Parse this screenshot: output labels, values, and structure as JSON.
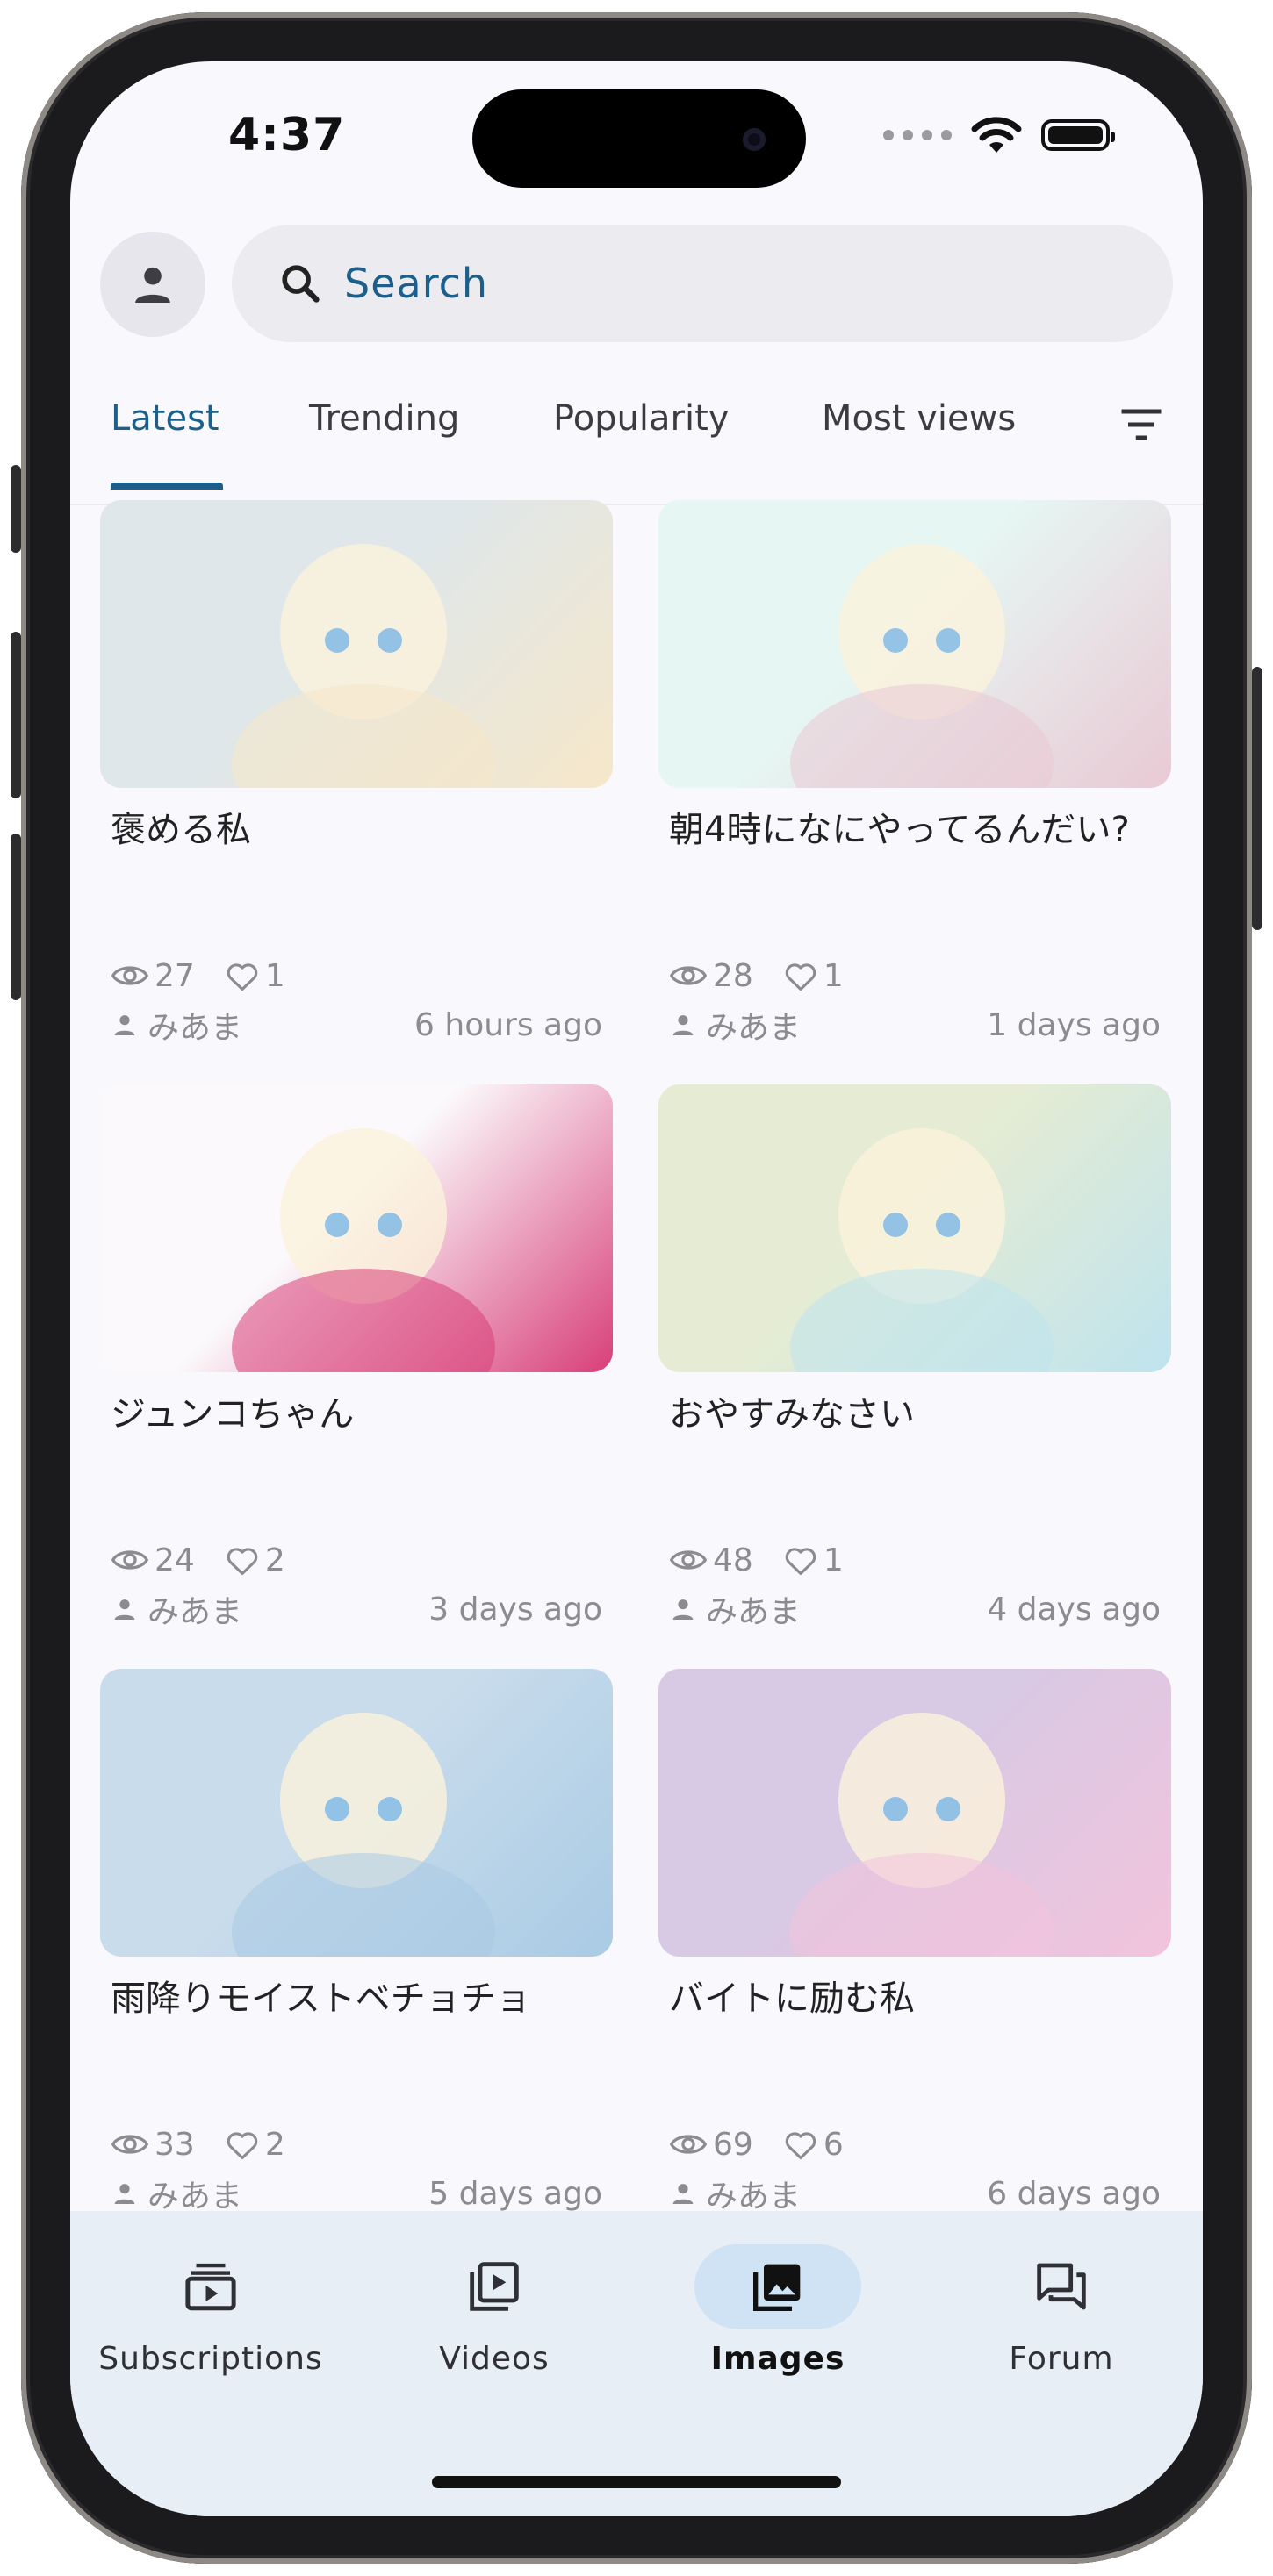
{
  "status_bar": {
    "time": "4:37"
  },
  "search": {
    "placeholder": "Search"
  },
  "tabs": [
    {
      "label": "Latest",
      "active": true
    },
    {
      "label": "Trending",
      "active": false
    },
    {
      "label": "Popularity",
      "active": false
    },
    {
      "label": "Most views",
      "active": false
    }
  ],
  "cards": [
    {
      "title": "褒める私",
      "views": "27",
      "likes": "1",
      "author": "みあま",
      "time": "6 hours ago",
      "thumb_colors": [
        "#dfe7ea",
        "#f6e7c9"
      ]
    },
    {
      "title": "朝4時になにやってるんだい?",
      "views": "28",
      "likes": "1",
      "author": "みあま",
      "time": "1 days ago",
      "thumb_colors": [
        "#e6f6f3",
        "#e9c9d4"
      ]
    },
    {
      "title": "ジュンコちゃん",
      "views": "24",
      "likes": "2",
      "author": "みあま",
      "time": "3 days ago",
      "thumb_colors": [
        "#fbf9fb",
        "#d83f79"
      ]
    },
    {
      "title": "おやすみなさい",
      "views": "48",
      "likes": "1",
      "author": "みあま",
      "time": "4 days ago",
      "thumb_colors": [
        "#e5ecd3",
        "#bfe3ee"
      ]
    },
    {
      "title": "雨降りモイストベチョチョ",
      "views": "33",
      "likes": "2",
      "author": "みあま",
      "time": "5 days ago",
      "thumb_colors": [
        "#c9dcec",
        "#a9cbe4"
      ]
    },
    {
      "title": "バイトに励む私",
      "views": "69",
      "likes": "6",
      "author": "みあま",
      "time": "6 days ago",
      "thumb_colors": [
        "#d8c9e4",
        "#f2c3dc"
      ]
    }
  ],
  "bottom_nav": [
    {
      "label": "Subscriptions",
      "icon": "subscriptions-icon",
      "active": false
    },
    {
      "label": "Videos",
      "icon": "video-library-icon",
      "active": false
    },
    {
      "label": "Images",
      "icon": "image-library-icon",
      "active": true
    },
    {
      "label": "Forum",
      "icon": "forum-icon",
      "active": false
    }
  ],
  "colors": {
    "accent": "#1c5f8a",
    "nav_bg": "#e7eef6",
    "nav_active_pill": "#cfe3f4"
  }
}
